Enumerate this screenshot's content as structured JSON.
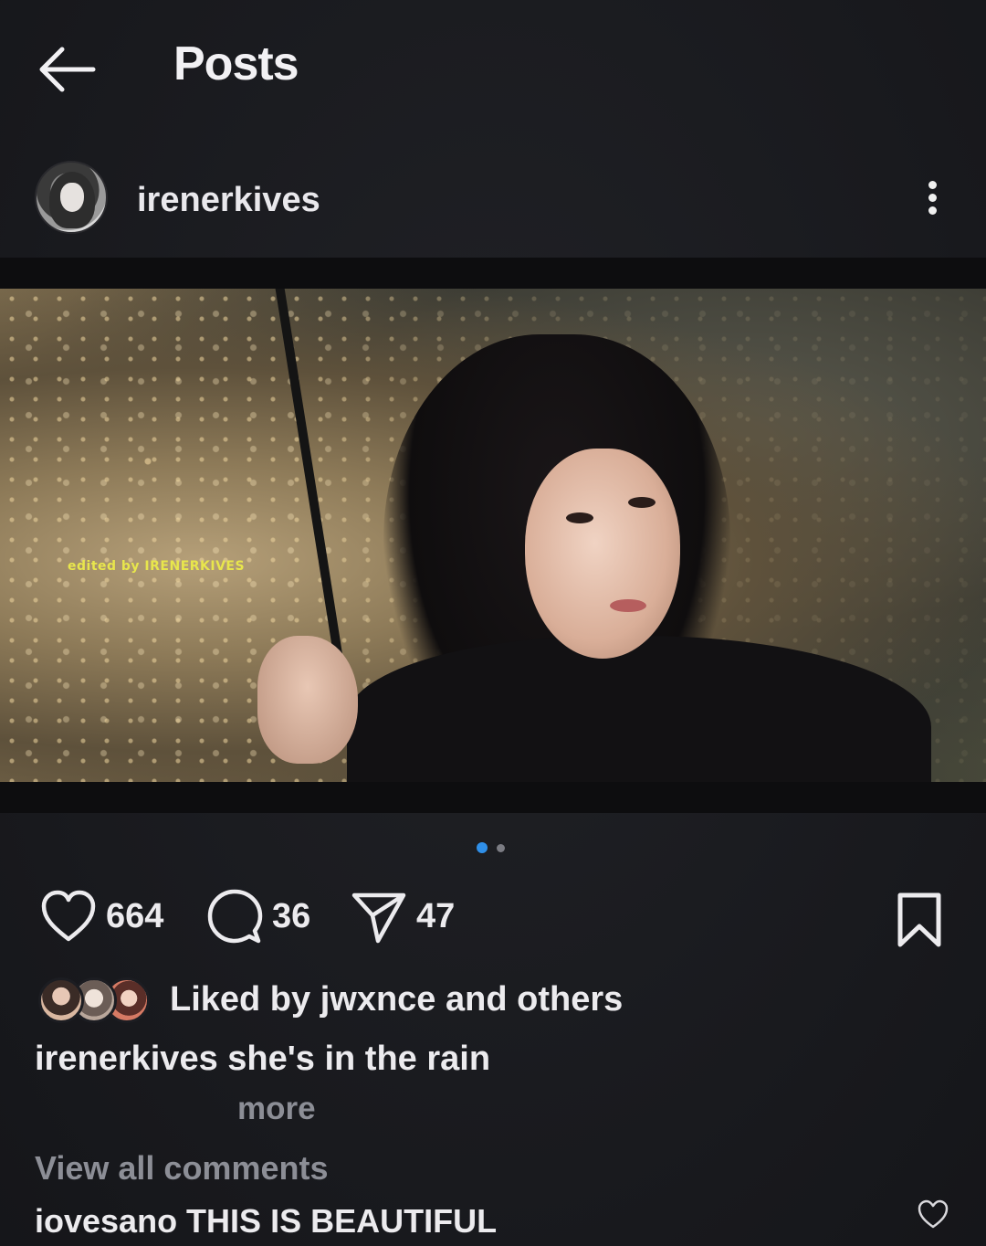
{
  "header": {
    "title": "Posts",
    "back_icon": "arrow-left-icon"
  },
  "post": {
    "username": "irenerkives",
    "media": {
      "watermark": "edited by IRENERKIVES",
      "description_colors": {
        "watermark": "#e8e64c"
      },
      "page_count": 2,
      "current_page": 1
    },
    "actions": {
      "likes": "664",
      "comments": "36",
      "shares": "47"
    },
    "liked_by": "Liked by jwxnce and others",
    "caption": "irenerkives she's in the rain",
    "more_label": "more",
    "view_comments": "View all comments",
    "top_comment": "iovesano THIS IS BEAUTIFUL"
  },
  "colors": {
    "background": "#1c1d22",
    "text": "#ecebee",
    "muted": "#8c8e96",
    "active_dot": "#2f8fe8"
  }
}
